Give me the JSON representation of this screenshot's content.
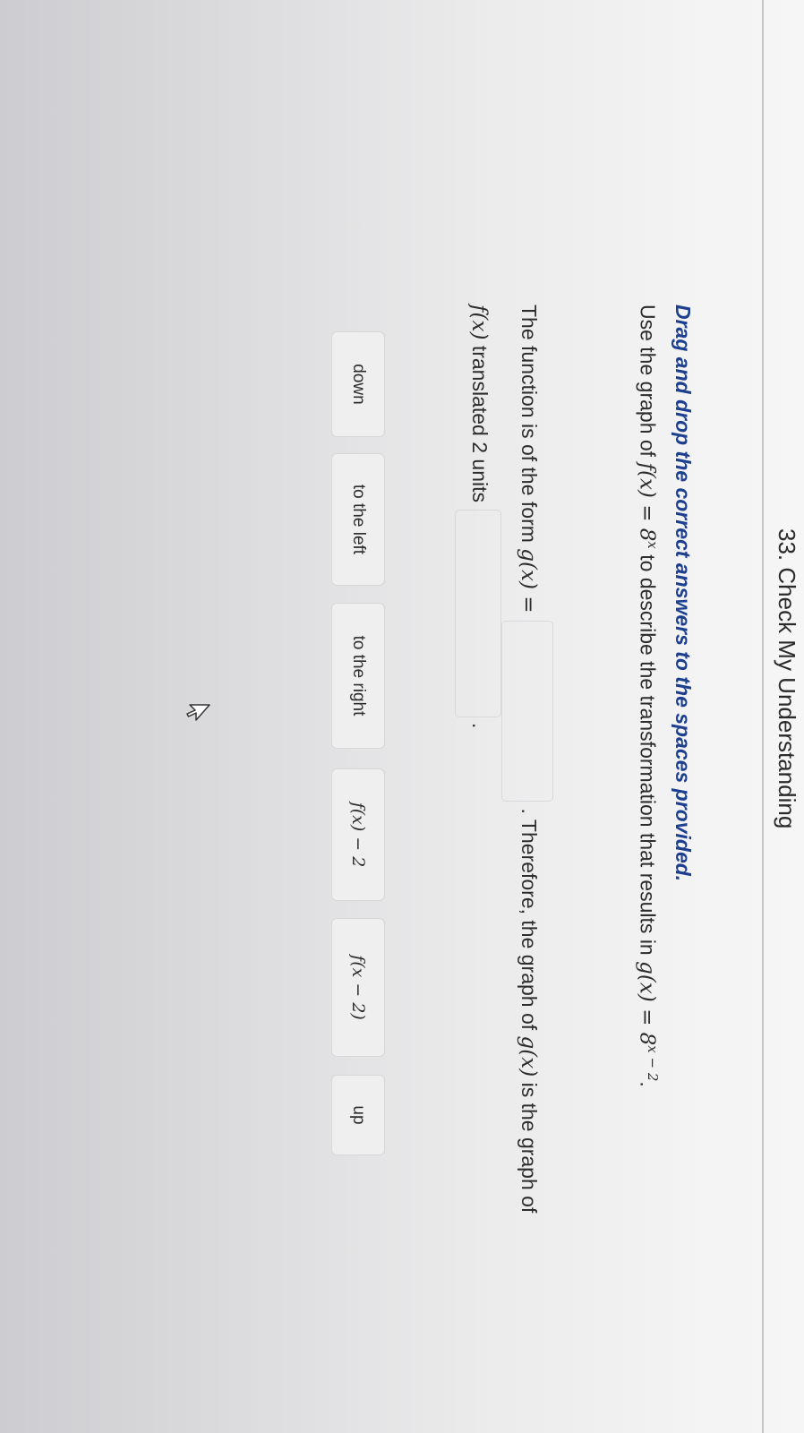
{
  "header": {
    "title": "33. Check My Understanding"
  },
  "prompt": {
    "title": "Drag and drop the correct answers to the spaces provided.",
    "instruction_pre": "Use the graph of ",
    "f_label": "f(x) = 8",
    "f_exp": "x",
    "instruction_mid": " to describe the transformation that results in ",
    "g_label": "g(x) = 8",
    "g_exp": "x − 2",
    "instruction_end": "."
  },
  "question": {
    "line1_pre": "The function is of the form ",
    "g_form": "g(x) =",
    "line1_mid": ". Therefore, the graph of ",
    "g_of_x": "g(x)",
    "line1_end": " is the graph of",
    "f_of_x": "f(x)",
    "line2_pre": " translated 2 units",
    "line2_end": "."
  },
  "tiles": [
    {
      "label": "down"
    },
    {
      "label": "to the left"
    },
    {
      "label": "to the right"
    },
    {
      "label": "f(x) − 2"
    },
    {
      "label": "f(x − 2)"
    },
    {
      "label": "up"
    }
  ],
  "icons": {
    "cursor": "cursor-arrow-icon"
  }
}
